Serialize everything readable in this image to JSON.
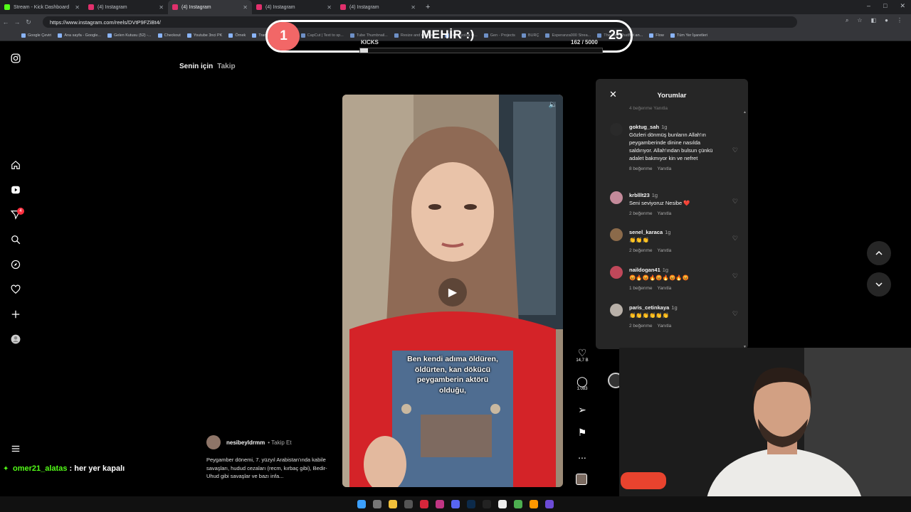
{
  "browser": {
    "tabs": [
      {
        "title": "Stream - Kick Dashboard",
        "color": "#53fc18"
      },
      {
        "title": "(4) Instagram",
        "color": "#e1306c"
      },
      {
        "title": "(4) Instagram",
        "color": "#e1306c",
        "active": true
      },
      {
        "title": "(4) Instagram",
        "color": "#e1306c"
      },
      {
        "title": "(4) Instagram",
        "color": "#e1306c"
      }
    ],
    "new_tab": "+",
    "window_controls": [
      "–",
      "□",
      "✕"
    ],
    "url": "https://www.instagram.com/reels/DVtP9FZiBt4/",
    "bookmarks": [
      "Google Çeviri",
      "Ana sayfa - Google...",
      "Gelen Kutusu (52) -...",
      "Checkout",
      "Youtube 3nci PK",
      "Örnek",
      "Transcript of \"Mi M...",
      "CapCut | Text to sp...",
      "Tube Thumbnail...",
      "Resize and reduce i...",
      "İspanyolca Ö...",
      "Gen - Projects",
      "BURÇ",
      "Esperanza000 Strea...",
      "The best ChatBot an...",
      "Flow",
      "Tüm Yer İşaretleri"
    ]
  },
  "instagram": {
    "feed_tabs": {
      "for_you": "Senin için",
      "following": "Takip"
    },
    "notification_count": "4",
    "reel": {
      "caption_lines": [
        "Ben kendi adıma öldüren,",
        "öldürten, kan dökücü",
        "peygamberin aktörü",
        "olduğu,"
      ],
      "author": "nesibeyldrmm",
      "follow_label": "• Takip Et",
      "description": "Peygamber dönemi, 7. yüzyıl Arabistan'ında kabile savaşları, hudud cezaları (recm, kırbaç gibi), Bedir-Uhud gibi savaşlar ve bazı infa...",
      "likes": "14,7 B",
      "comments_count": "1.083",
      "more": "..."
    },
    "comments_panel": {
      "title": "Yorumlar",
      "top_hint": "4 beğenme    Yanıtla",
      "comments": [
        {
          "user": "goktug_sah",
          "time": "1g",
          "text": "Gözleri dönmüş bunların Allah'ın peygamberinde dinine nasılda saldırıyor. Allah'ından bulsun çünkü adalet bakmıyor kin ve nefret",
          "likes": "8 beğenme",
          "reply": "Yanıtla",
          "avatar_color": "#2a2a2a"
        },
        {
          "user": "krblllt23",
          "time": "1g",
          "text": "Seni seviyoruz Nesibe ❤️",
          "likes": "2 beğenme",
          "reply": "Yanıtla",
          "avatar_color": "#c48a9a"
        },
        {
          "user": "senel_karaca",
          "time": "1g",
          "text": "👏👏👏",
          "likes": "2 beğenme",
          "reply": "Yanıtla",
          "avatar_color": "#8b6a4a"
        },
        {
          "user": "naildogan41",
          "time": "1g",
          "text": "😡🔥😡🔥😡🔥😡🔥😡",
          "likes": "1 beğenme",
          "reply": "Yanıtla",
          "avatar_color": "#c0485a"
        },
        {
          "user": "paris_cetinkaya",
          "time": "1g",
          "text": "👏👏👏👏👏👏",
          "likes": "2 beğenme",
          "reply": "Yanıtla",
          "avatar_color": "#b8b0a8"
        }
      ]
    }
  },
  "stream_overlay": {
    "goal_index": "1",
    "goal_name": "MEHİR :)",
    "goal_target_short": "25",
    "label": "KICKS",
    "progress_text": "162  / 5000",
    "progress_fraction": 0.0324,
    "chat": {
      "user": "omer21_alatas",
      "separator": ":",
      "message": "her yer kapalı"
    }
  }
}
